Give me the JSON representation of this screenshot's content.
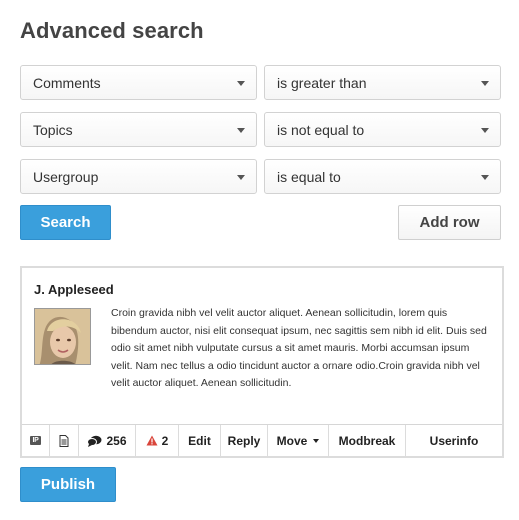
{
  "page": {
    "title": "Advanced search"
  },
  "filters": [
    {
      "field": "Comments",
      "operator": "is greater than"
    },
    {
      "field": "Topics",
      "operator": "is not equal to"
    },
    {
      "field": "Usergroup",
      "operator": "is equal to"
    }
  ],
  "actions": {
    "search_label": "Search",
    "add_row_label": "Add row",
    "publish_label": "Publish"
  },
  "post": {
    "author": "J. Appleseed",
    "text": "Croin gravida nibh vel velit auctor aliquet. Aenean sollicitudin, lorem quis bibendum auctor, nisi elit consequat ipsum, nec sagittis sem nibh id elit. Duis sed odio sit amet nibh vulputate cursus a sit amet mauris. Morbi accumsan ipsum velit. Nam nec tellus a odio tincidunt auctor a ornare odio.Croin gravida nibh vel velit auctor aliquet. Aenean sollicitudin.",
    "toolbar": {
      "ip_label": "IP",
      "comment_count": "256",
      "warning_count": "2",
      "edit": "Edit",
      "reply": "Reply",
      "move": "Move",
      "modbreak": "Modbreak",
      "userinfo": "Userinfo"
    }
  },
  "colors": {
    "accent": "#3a9fdc",
    "warning": "#d9453b"
  },
  "icons": [
    "ip-icon",
    "document-icon",
    "comments-icon",
    "warning-icon",
    "chevron-down-icon"
  ]
}
